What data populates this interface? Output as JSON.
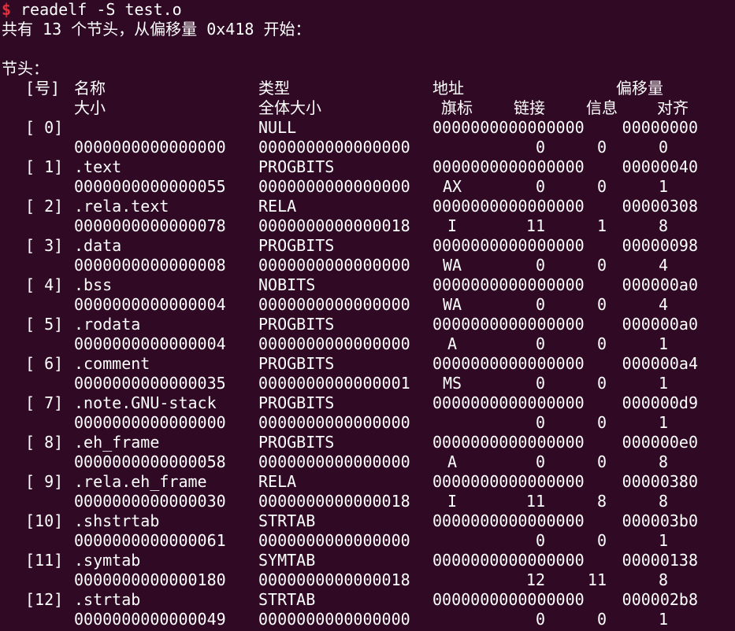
{
  "terminal": {
    "prompt_symbol": "$",
    "command": "readelf -S test.o",
    "summary": "共有 13 个节头，从偏移量 0x418 开始：",
    "section_headers_title": "节头："
  },
  "table": {
    "headers": {
      "num": "[号]",
      "name": "名称",
      "type": "类型",
      "address": "地址",
      "offset": "偏移量",
      "size": "大小",
      "entsize": "全体大小",
      "flags": "旗标",
      "link": "链接",
      "info": "信息",
      "align": "对齐"
    },
    "sections": [
      {
        "num": "[ 0]",
        "name": "",
        "type": "NULL",
        "address": "0000000000000000",
        "offset": "00000000",
        "size": "0000000000000000",
        "entsize": "0000000000000000",
        "flags": "",
        "link": "0",
        "info": "0",
        "align": "0"
      },
      {
        "num": "[ 1]",
        "name": ".text",
        "type": "PROGBITS",
        "address": "0000000000000000",
        "offset": "00000040",
        "size": "0000000000000055",
        "entsize": "0000000000000000",
        "flags": "AX",
        "link": "0",
        "info": "0",
        "align": "1"
      },
      {
        "num": "[ 2]",
        "name": ".rela.text",
        "type": "RELA",
        "address": "0000000000000000",
        "offset": "00000308",
        "size": "0000000000000078",
        "entsize": "0000000000000018",
        "flags": "I",
        "link": "11",
        "info": "1",
        "align": "8"
      },
      {
        "num": "[ 3]",
        "name": ".data",
        "type": "PROGBITS",
        "address": "0000000000000000",
        "offset": "00000098",
        "size": "0000000000000008",
        "entsize": "0000000000000000",
        "flags": "WA",
        "link": "0",
        "info": "0",
        "align": "4"
      },
      {
        "num": "[ 4]",
        "name": ".bss",
        "type": "NOBITS",
        "address": "0000000000000000",
        "offset": "000000a0",
        "size": "0000000000000004",
        "entsize": "0000000000000000",
        "flags": "WA",
        "link": "0",
        "info": "0",
        "align": "4"
      },
      {
        "num": "[ 5]",
        "name": ".rodata",
        "type": "PROGBITS",
        "address": "0000000000000000",
        "offset": "000000a0",
        "size": "0000000000000004",
        "entsize": "0000000000000000",
        "flags": "A",
        "link": "0",
        "info": "0",
        "align": "1"
      },
      {
        "num": "[ 6]",
        "name": ".comment",
        "type": "PROGBITS",
        "address": "0000000000000000",
        "offset": "000000a4",
        "size": "0000000000000035",
        "entsize": "0000000000000001",
        "flags": "MS",
        "link": "0",
        "info": "0",
        "align": "1"
      },
      {
        "num": "[ 7]",
        "name": ".note.GNU-stack",
        "type": "PROGBITS",
        "address": "0000000000000000",
        "offset": "000000d9",
        "size": "0000000000000000",
        "entsize": "0000000000000000",
        "flags": "",
        "link": "0",
        "info": "0",
        "align": "1"
      },
      {
        "num": "[ 8]",
        "name": ".eh_frame",
        "type": "PROGBITS",
        "address": "0000000000000000",
        "offset": "000000e0",
        "size": "0000000000000058",
        "entsize": "0000000000000000",
        "flags": "A",
        "link": "0",
        "info": "0",
        "align": "8"
      },
      {
        "num": "[ 9]",
        "name": ".rela.eh_frame",
        "type": "RELA",
        "address": "0000000000000000",
        "offset": "00000380",
        "size": "0000000000000030",
        "entsize": "0000000000000018",
        "flags": "I",
        "link": "11",
        "info": "8",
        "align": "8"
      },
      {
        "num": "[10]",
        "name": ".shstrtab",
        "type": "STRTAB",
        "address": "0000000000000000",
        "offset": "000003b0",
        "size": "0000000000000061",
        "entsize": "0000000000000000",
        "flags": "",
        "link": "0",
        "info": "0",
        "align": "1"
      },
      {
        "num": "[11]",
        "name": ".symtab",
        "type": "SYMTAB",
        "address": "0000000000000000",
        "offset": "00000138",
        "size": "0000000000000180",
        "entsize": "0000000000000018",
        "flags": "",
        "link": "12",
        "info": "11",
        "align": "8"
      },
      {
        "num": "[12]",
        "name": ".strtab",
        "type": "STRTAB",
        "address": "0000000000000000",
        "offset": "000002b8",
        "size": "0000000000000049",
        "entsize": "0000000000000000",
        "flags": "",
        "link": "0",
        "info": "0",
        "align": "1"
      }
    ]
  },
  "colors": {
    "background": "#300a24",
    "text": "#ffffff",
    "prompt": "#e0323e"
  }
}
